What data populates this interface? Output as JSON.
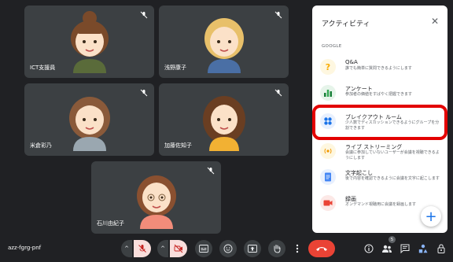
{
  "participants": [
    {
      "name": "ICT支援員"
    },
    {
      "name": "浅野康子"
    },
    {
      "name": "米倉彩乃"
    },
    {
      "name": "加藤佐知子"
    },
    {
      "name": "石川由紀子"
    }
  ],
  "activities_panel": {
    "title": "アクティビティ",
    "section": "GOOGLE",
    "items": [
      {
        "title": "Q&A",
        "desc": "誰でも簡単に質問できるようにします",
        "icon": "qa-icon"
      },
      {
        "title": "アンケート",
        "desc": "参加者の価値をすばやく把握できます",
        "icon": "poll-icon"
      },
      {
        "title": "ブレイクアウト ルーム",
        "desc": "少人数でディスカッションできるようにグループを分割できます",
        "icon": "breakout-icon"
      },
      {
        "title": "ライブ ストリーミング",
        "desc": "会議に参加していないユーザーが会議を視聴できるようにします",
        "icon": "live-stream-icon"
      },
      {
        "title": "文字起こし",
        "desc": "後で内容を確認できるように会議を文字に起こします",
        "icon": "transcript-icon"
      },
      {
        "title": "録画",
        "desc": "オンデマンド視聴用に会議を録画します",
        "icon": "record-icon"
      }
    ],
    "fab_label": "+"
  },
  "bottom_bar": {
    "meeting_code": "azz-fgrg-pnf",
    "participant_count": "5"
  },
  "colors": {
    "background": "#202124",
    "tile": "#3c4043",
    "muted_red": "#f9dedc",
    "hangup": "#ea4335",
    "highlight": "#e30000",
    "accent": "#1a73e8"
  }
}
